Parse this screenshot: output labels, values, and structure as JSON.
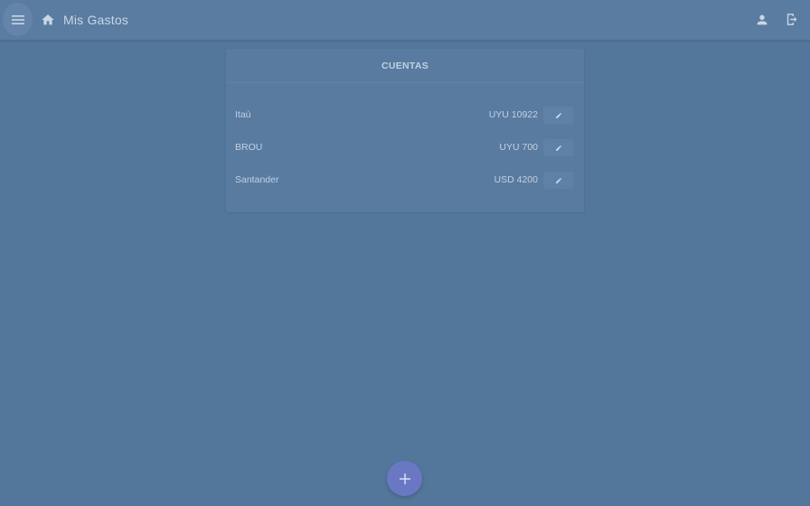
{
  "header": {
    "title": "Mis Gastos",
    "icons": [
      "menu-icon",
      "home-icon",
      "user-icon",
      "logout-icon"
    ]
  },
  "accounts_card": {
    "title": "CUENTAS",
    "accounts": [
      {
        "name": "Itaú",
        "balance": "UYU 10922"
      },
      {
        "name": "BROU",
        "balance": "UYU 700"
      },
      {
        "name": "Santander",
        "balance": "USD 4200"
      }
    ]
  },
  "fab": {
    "label": "+"
  },
  "colors": {
    "background": "#53769b",
    "appbar": "#5a7ca1",
    "card": "#597ba0",
    "text": "#c2d1e3",
    "fab": "#6a78c4"
  }
}
